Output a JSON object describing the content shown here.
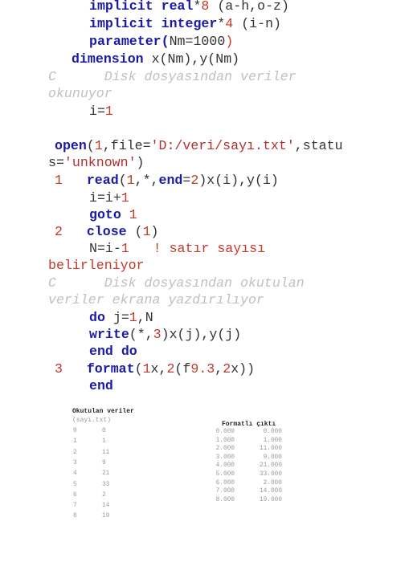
{
  "code": {
    "line1": {
      "kw": "implicit real",
      "op": "*",
      "num": "8",
      "rest": " (a-h,o-z)"
    },
    "line2": {
      "kw": "implicit integer",
      "op": "*",
      "num": "4",
      "rest": " (i-n)"
    },
    "line3": {
      "kw": "parameter",
      "open": "(",
      "body": "Nm=",
      "num": "1000",
      "close": ")"
    },
    "line4": {
      "kw": "dimension",
      "rest": " x(Nm),y(Nm)"
    },
    "comment1_a": "C      Disk dosyasından veriler",
    "comment1_b": "okunuyor",
    "line5": {
      "lhs": "i=",
      "num": "1"
    },
    "line6": {
      "kw": "open",
      "a": "(",
      "n": "1",
      "b": ",file=",
      "s": "'D:/veri/sayı.txt'",
      "c": ",statu"
    },
    "line6b": {
      "a": "s=",
      "s": "'unknown'",
      "c": ")"
    },
    "line7": {
      "label": "1",
      "kw": "read",
      "a": "(",
      "n1": "1",
      "b": ",*,",
      "kw2": "end",
      "c": "=",
      "n2": "2",
      "d": ")x(i),y(i)"
    },
    "line8": {
      "a": "i=i+",
      "n": "1"
    },
    "line9": {
      "kw": "goto",
      "n": " 1"
    },
    "line10": {
      "label": "2",
      "kw": "close",
      "a": " (",
      "n": "1",
      "b": ")"
    },
    "line11": {
      "a": "N=i-",
      "n": "1",
      "cm": "   ! satır sayısı"
    },
    "line11b": "belirleniyor",
    "comment2_a": "C      Disk dosyasından okutulan",
    "comment2_b": "veriler ekrana yazdırılıyor",
    "line12": {
      "kw": "do",
      "a": " j=",
      "n": "1",
      "b": ",N"
    },
    "line13": {
      "kw": "write",
      "a": "(*,",
      "n": "3",
      "b": ")x(j),y(j)"
    },
    "line14": {
      "kw": "end do"
    },
    "line15": {
      "label": "3",
      "kw": "format",
      "a": "(",
      "n1": "1",
      "b": "x,",
      "n2": "2",
      "c": "(f",
      "n3": "9",
      "d": ".",
      "n4": "3",
      "e": ",",
      "n5": "2",
      "f": "x))"
    },
    "line16": {
      "kw": "end"
    }
  },
  "read_table": {
    "title": "Okutulan veriler",
    "subtitle": "(sayı.txt)",
    "rows": [
      [
        "0",
        "0"
      ],
      [
        "1",
        "1"
      ],
      [
        "2",
        "11"
      ],
      [
        "3",
        "9"
      ],
      [
        "4",
        "21"
      ],
      [
        "5",
        "33"
      ],
      [
        "6",
        "2"
      ],
      [
        "7",
        "14"
      ],
      [
        "8",
        "19"
      ]
    ]
  },
  "formatted_table": {
    "title": "Formatlı çıktı",
    "rows": [
      [
        "0.000",
        "0.000"
      ],
      [
        "1.000",
        "1.000"
      ],
      [
        "2.000",
        "11.000"
      ],
      [
        "3.000",
        "9.000"
      ],
      [
        "4.000",
        "21.000"
      ],
      [
        "5.000",
        "33.000"
      ],
      [
        "6.000",
        "2.000"
      ],
      [
        "7.000",
        "14.000"
      ],
      [
        "8.000",
        "19.000"
      ]
    ]
  }
}
